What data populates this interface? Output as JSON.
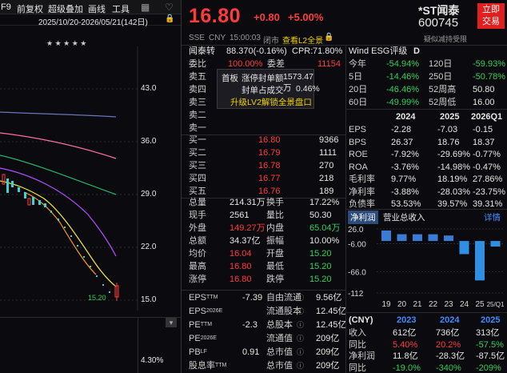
{
  "toolbar": {
    "f9": "F9",
    "fq": "前复权",
    "overlay": "超级叠加",
    "draw": "画线",
    "tools": "工具",
    "grid": "▦",
    "heart": "♡",
    "range": "2025/10/20-2026/05/21(142日)",
    "lock": "🔒",
    "stars": "★  ★    ★   ★   ★"
  },
  "chart": {
    "prices": [
      "43.0",
      "36.0",
      "29.0",
      "22.0",
      "15.0"
    ],
    "low": "15.20",
    "pct": "4.30%"
  },
  "quote": {
    "price": "16.80",
    "change": "+0.80",
    "pct": "+5.00%",
    "name": "*ST闻泰",
    "code": "600745",
    "btn": "立即\n交易",
    "exch": "SSE",
    "cur": "CNY",
    "time": "15:00:03",
    "status": "闭市",
    "l2": "查看L2全景",
    "lock": "🔒",
    "tag": "疑似减持受限"
  },
  "sub": {
    "name": "闻泰转",
    "val": "88.370(-0.16%)",
    "cpr_l": "CPR:",
    "cpr": "71.80%"
  },
  "wb": {
    "l1": "委比",
    "v1": "100.00%",
    "l2": "委差",
    "v2": "11154"
  },
  "popup": {
    "r1a": "首板",
    "r1b": "涨停封单额",
    "r1c": "1573.47万",
    "r2a": "封单占成交",
    "r2b": "0.46%",
    "r3": "升级LV2解锁全景盘口"
  },
  "asks": [
    {
      "l": "卖五",
      "p": "",
      "v": ""
    },
    {
      "l": "卖四",
      "p": "",
      "v": ""
    },
    {
      "l": "卖三",
      "p": "",
      "v": ""
    },
    {
      "l": "卖二",
      "p": "",
      "v": ""
    },
    {
      "l": "卖一",
      "p": "",
      "v": ""
    }
  ],
  "bids": [
    {
      "l": "买一",
      "p": "16.80",
      "v": "9366"
    },
    {
      "l": "买二",
      "p": "16.79",
      "v": "1111"
    },
    {
      "l": "买三",
      "p": "16.78",
      "v": "270"
    },
    {
      "l": "买四",
      "p": "16.77",
      "v": "218"
    },
    {
      "l": "买五",
      "p": "16.76",
      "v": "189"
    }
  ],
  "stats": [
    {
      "a": "总量",
      "av": "214.31万",
      "b": "换手",
      "bv": "17.22%",
      "ac": "white",
      "bc": "white"
    },
    {
      "a": "现手",
      "av": "2561",
      "b": "量比",
      "bv": "50.30",
      "ac": "white",
      "bc": "white"
    },
    {
      "a": "外盘",
      "av": "149.27万",
      "b": "内盘",
      "bv": "65.04万",
      "ac": "red",
      "bc": "green"
    },
    {
      "a": "总额",
      "av": "34.37亿",
      "b": "振幅",
      "bv": "10.00%",
      "ac": "white",
      "bc": "white"
    },
    {
      "a": "均价",
      "av": "16.04",
      "b": "开盘",
      "bv": "15.20",
      "ac": "red",
      "bc": "green"
    },
    {
      "a": "最高",
      "av": "16.80",
      "b": "最低",
      "bv": "15.20",
      "ac": "red",
      "bc": "green"
    },
    {
      "a": "涨停",
      "av": "16.80",
      "b": "跌停",
      "bv": "15.20",
      "ac": "red",
      "bc": "green"
    }
  ],
  "val": [
    {
      "a": "EPS",
      "as": "TTM",
      "av": "-7.39",
      "b": "自由流通",
      "bv": "9.56亿"
    },
    {
      "a": "EPS",
      "as": "2026E",
      "av": "",
      "b": "流通股本",
      "bv": "12.45亿"
    },
    {
      "a": "PE",
      "as": "TTM",
      "av": "-2.3",
      "b": "总股本",
      "bv": "12.45亿"
    },
    {
      "a": "PE",
      "as": "2026E",
      "av": "",
      "b": "流通值",
      "bv": "209亿"
    },
    {
      "a": "PB",
      "as": "LF",
      "av": "0.91",
      "b": "总市值",
      "bv": "209亿"
    },
    {
      "a": "股息率",
      "as": "TTM",
      "av": "",
      "b": "总市值",
      "bv": "209亿"
    }
  ],
  "esg": {
    "l": "Wind ESG评级",
    "v": "D"
  },
  "perf": [
    {
      "a": "今年",
      "av": "-54.94%",
      "b": "120日",
      "bv": "-59.93%",
      "bc": "green"
    },
    {
      "a": "5日",
      "av": "-14.46%",
      "b": "250日",
      "bv": "-50.78%",
      "bc": "green"
    },
    {
      "a": "20日",
      "av": "-46.46%",
      "b": "52周高",
      "bv": "50.80",
      "bc": "white"
    },
    {
      "a": "60日",
      "av": "-49.99%",
      "b": "52周低",
      "bv": "16.00",
      "bc": "white"
    }
  ],
  "fin": {
    "years": [
      "2024",
      "2025",
      "2026Q1"
    ],
    "rows": [
      {
        "l": "EPS",
        "v": [
          "-2.28",
          "-7.03",
          "-0.15"
        ]
      },
      {
        "l": "BPS",
        "v": [
          "26.37",
          "18.76",
          "18.37"
        ]
      },
      {
        "l": "ROE",
        "v": [
          "-7.92%",
          "-29.69%",
          "-0.77%"
        ]
      },
      {
        "l": "ROA",
        "v": [
          "-3.76%",
          "-14.98%",
          "-0.47%"
        ]
      },
      {
        "l": "毛利率",
        "v": [
          "9.77%",
          "18.19%",
          "27.86%"
        ]
      },
      {
        "l": "净利率",
        "v": [
          "-3.88%",
          "-28.03%",
          "-23.75%"
        ]
      },
      {
        "l": "负债率",
        "v": [
          "53.53%",
          "39.57%",
          "39.31%"
        ]
      }
    ]
  },
  "tabs": {
    "t1": "净利润",
    "t2": "营业总收入",
    "detail": "详情"
  },
  "chart_data": {
    "type": "bar",
    "categories": [
      "19",
      "20",
      "21",
      "22",
      "23",
      "24",
      "25",
      "25/Q1"
    ],
    "values": [
      22.6,
      14.6,
      14.5,
      14.5,
      11.8,
      -28.3,
      -85.0,
      -12.0
    ],
    "yticks": [
      "26.0",
      "-6.00",
      "-66.0",
      "-112"
    ],
    "ylim": [
      -112,
      26
    ],
    "title": "",
    "xlabel": "",
    "ylabel": ""
  },
  "cny": {
    "l": "(CNY)",
    "years": [
      "2023",
      "2024",
      "2025"
    ],
    "rows": [
      {
        "l": "收入",
        "v": [
          "612亿",
          "736亿",
          "313亿"
        ],
        "c": [
          "white",
          "white",
          "white"
        ]
      },
      {
        "l": "同比",
        "v": [
          "5.40%",
          "20.2%",
          "-57.5%"
        ],
        "c": [
          "red",
          "red",
          "green"
        ]
      },
      {
        "l": "净利润",
        "v": [
          "11.8亿",
          "-28.3亿",
          "-87.5亿"
        ],
        "c": [
          "white",
          "white",
          "white"
        ]
      },
      {
        "l": "同比",
        "v": [
          "-19.0%",
          "-340%",
          "-209%"
        ],
        "c": [
          "green",
          "green",
          "green"
        ]
      }
    ]
  }
}
